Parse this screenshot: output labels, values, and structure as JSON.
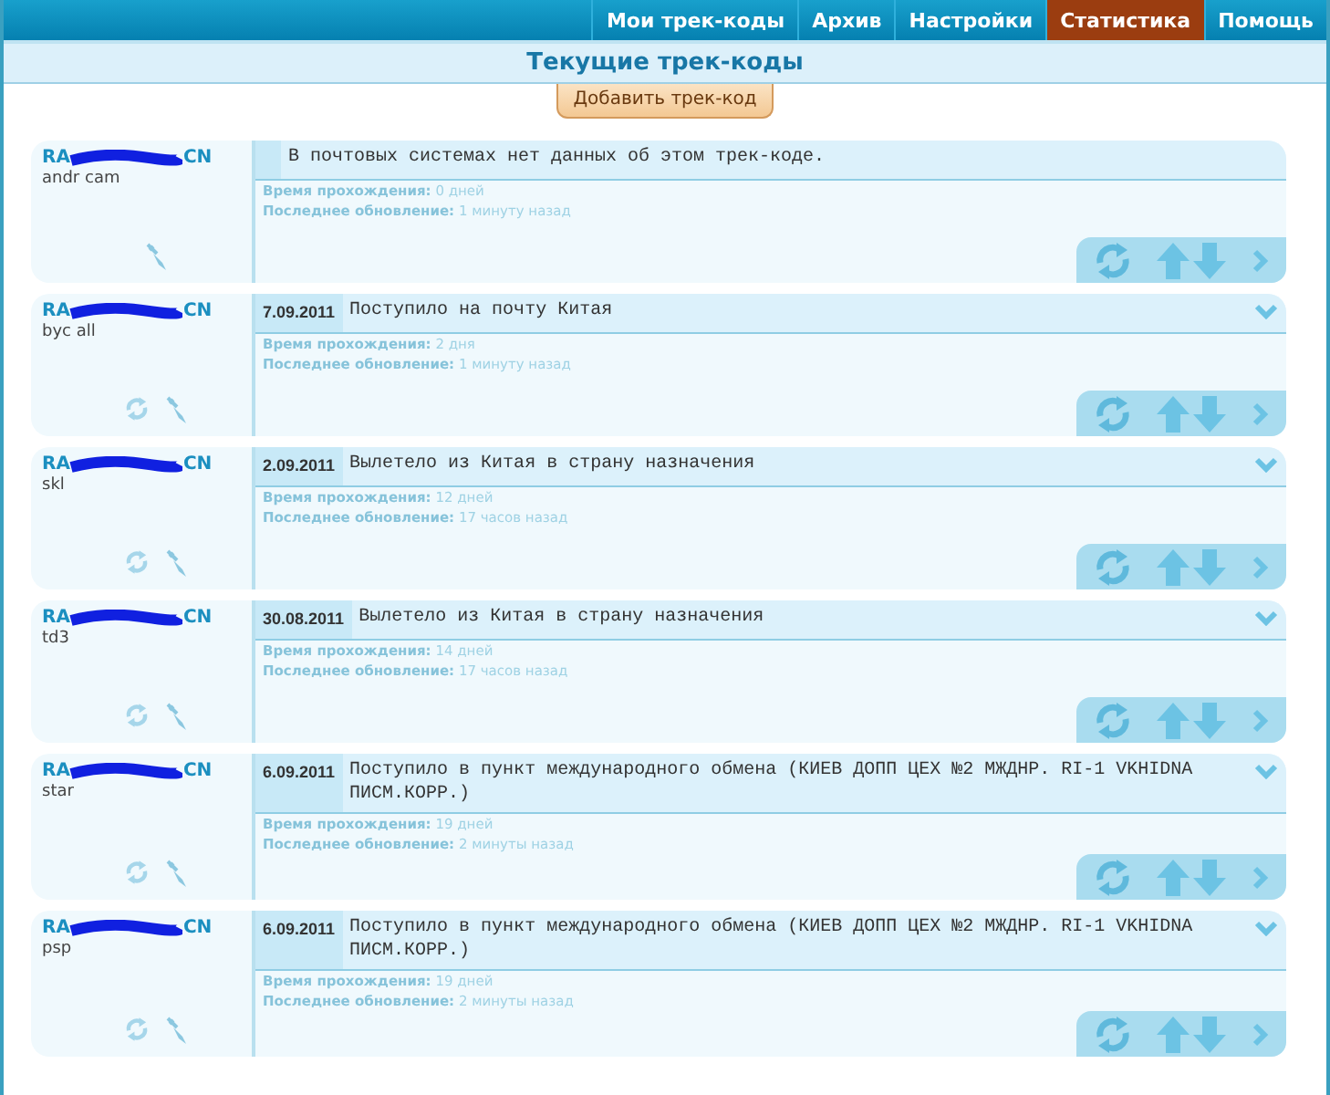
{
  "nav": [
    {
      "label": "Мои трек-коды",
      "selected": false
    },
    {
      "label": "Архив",
      "selected": false
    },
    {
      "label": "Настройки",
      "selected": false
    },
    {
      "label": "Статистика",
      "selected": true
    },
    {
      "label": "Помощь",
      "selected": false
    }
  ],
  "title": "Текущие трек-коды",
  "add_button": "Добавить трек-код",
  "tracks": [
    {
      "code_start": "RA",
      "code_end": "CN",
      "name": "andr cam",
      "refreshable": false,
      "expandable": false,
      "message": "В почтовых системах нет данных об этом трек-коде.",
      "time_label": "Время прохождения:",
      "time_value": "0 дней",
      "update_label": "Последнее обновление:",
      "update_value": "1 минуту назад"
    },
    {
      "code_start": "RA",
      "code_end": "CN",
      "name": "byc all",
      "refreshable": true,
      "expandable": true,
      "date": "7.09.2011",
      "message": "Поступило на почту Китая",
      "time_label": "Время прохождения:",
      "time_value": "2 дня",
      "update_label": "Последнее обновление:",
      "update_value": "1 минуту назад"
    },
    {
      "code_start": "RA",
      "code_end": "CN",
      "name": "skl",
      "refreshable": true,
      "expandable": true,
      "date": "2.09.2011",
      "message": "Вылетело из Китая в страну назначения",
      "time_label": "Время прохождения:",
      "time_value": "12 дней",
      "update_label": "Последнее обновление:",
      "update_value": "17 часов назад"
    },
    {
      "code_start": "RA",
      "code_end": "CN",
      "name": "td3",
      "refreshable": true,
      "expandable": true,
      "date": "30.08.2011",
      "message": "Вылетело из Китая в страну назначения",
      "time_label": "Время прохождения:",
      "time_value": "14 дней",
      "update_label": "Последнее обновление:",
      "update_value": "17 часов назад"
    },
    {
      "code_start": "RA",
      "code_end": "CN",
      "name": "star",
      "refreshable": true,
      "expandable": true,
      "date": "6.09.2011",
      "message": "Поступило в пункт международного обмена (КИЕВ ДОПП ЦЕХ №2 МЖДНР. RI-1 VKHIDNA ПИСМ.КОРР.)",
      "time_label": "Время прохождения:",
      "time_value": "19 дней",
      "update_label": "Последнее обновление:",
      "update_value": "2 минуты назад"
    },
    {
      "code_start": "RA",
      "code_end": "CN",
      "name": "psp",
      "refreshable": true,
      "expandable": true,
      "date": "6.09.2011",
      "message": "Поступило в пункт международного обмена (КИЕВ ДОПП ЦЕХ №2 МЖДНР. RI-1 VKHIDNA ПИСМ.КОРР.)",
      "time_label": "Время прохождения:",
      "time_value": "19 дней",
      "update_label": "Последнее обновление:",
      "update_value": "2 минуты назад"
    }
  ]
}
